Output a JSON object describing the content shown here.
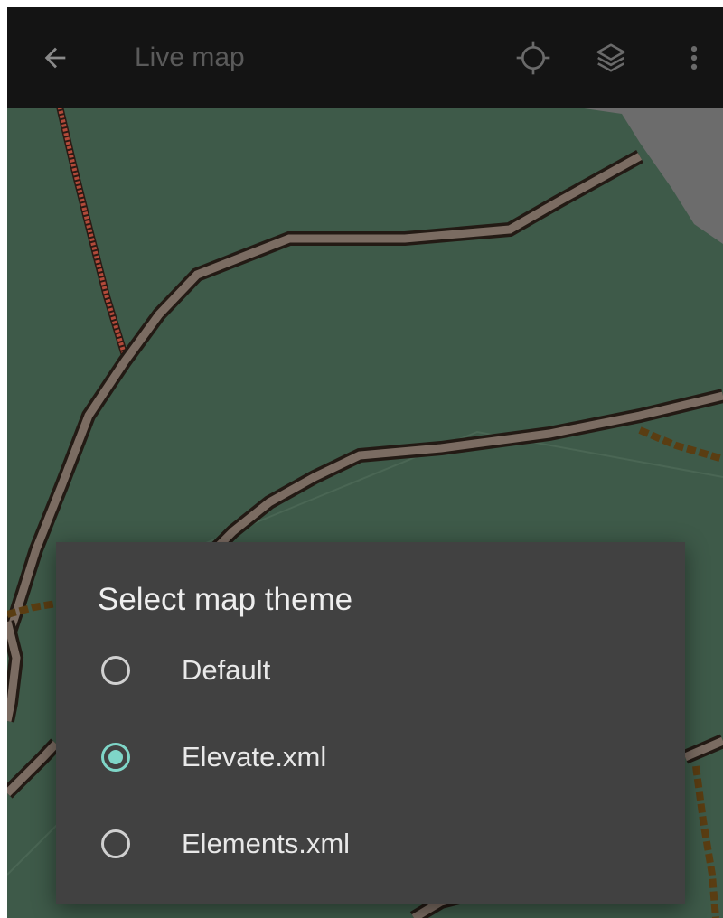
{
  "app_bar": {
    "title": "Live map",
    "back_icon": "arrow-back-icon",
    "location_icon": "my-location-icon",
    "layers_icon": "layers-icon",
    "menu_icon": "more-vert-icon"
  },
  "dialog": {
    "title": "Select map theme",
    "options": [
      {
        "label": "Default",
        "selected": false
      },
      {
        "label": "Elevate.xml",
        "selected": true
      },
      {
        "label": "Elements.xml",
        "selected": false
      }
    ]
  },
  "colors": {
    "app_bar_bg": "#141414",
    "map_green": "#3d5848",
    "dialog_bg": "#414141",
    "accent": "#7fd6c8"
  }
}
